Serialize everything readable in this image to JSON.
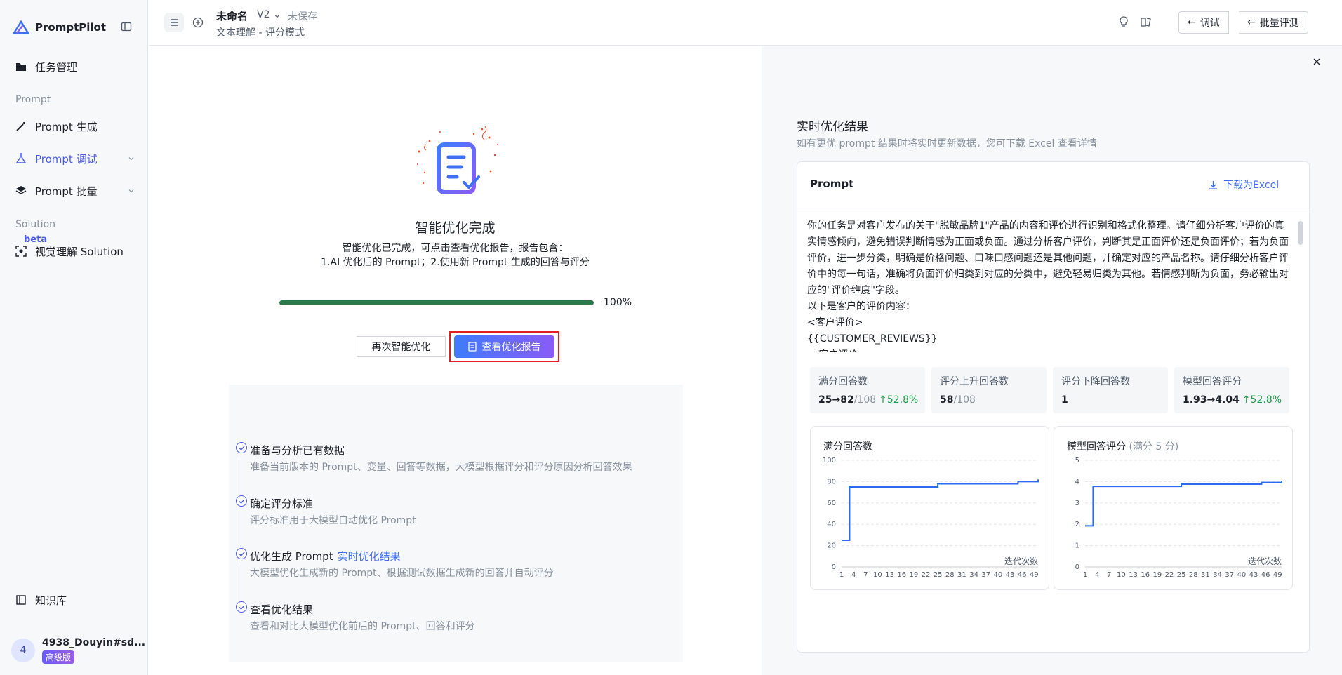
{
  "sidebar": {
    "brand": "PromptPilot",
    "items": [
      {
        "label": "任务管理",
        "icon": "folder-icon"
      },
      {
        "label": "Prompt 生成",
        "icon": "magic-wand-icon"
      },
      {
        "label": "Prompt 调试",
        "icon": "flask-icon",
        "active": true
      },
      {
        "label": "Prompt 批量",
        "icon": "stack-icon"
      },
      {
        "label": "视觉理解 Solution",
        "icon": "eye-scan-icon"
      },
      {
        "label": "知识库",
        "icon": "book-icon"
      }
    ],
    "groups": {
      "prompt": "Prompt",
      "solution": "Solution"
    },
    "beta": "beta",
    "user": {
      "avatar": "4",
      "name": "4938_Douyin#sd...",
      "tier": "高级版"
    }
  },
  "header": {
    "doc_title": "未命名",
    "version": "V2",
    "status": "未保存",
    "subtitle": "文本理解 - 评分模式",
    "debug_btn": "调试",
    "batch_btn": "批量评测"
  },
  "main": {
    "success_title": "智能优化完成",
    "success_desc_1": "智能优化已完成，可点击查看优化报告，报告包含：",
    "success_desc_2": "1.AI 优化后的 Prompt；2.使用新 Prompt 生成的回答与评分",
    "progress": 1.0,
    "progress_label": "100%",
    "retry_btn": "再次智能优化",
    "report_btn": "查看优化报告",
    "steps": [
      {
        "title": "准备与分析已有数据",
        "desc": "准备当前版本的 Prompt、变量、回答等数据，大模型根据评分和评分原因分析回答效果"
      },
      {
        "title": "确定评分标准",
        "desc": "评分标准用于大模型自动优化 Prompt"
      },
      {
        "title": "优化生成 Prompt",
        "link": "实时优化结果",
        "desc": "大模型优化生成新的 Prompt、根据测试数据生成新的回答并自动评分"
      },
      {
        "title": "查看优化结果",
        "desc": "查看和对比大模型优化前后的 Prompt、回答和评分"
      }
    ]
  },
  "right": {
    "title": "实时优化结果",
    "subtitle": "如有更优 prompt 结果时将实时更新数据，您可下载 Excel 查看详情",
    "card_title": "Prompt",
    "download": "下载为Excel",
    "prompt_text": "你的任务是对客户发布的关于\"脱敏品牌1\"产品的内容和评价进行识别和格式化整理。请仔细分析客户评价的真实情感倾向，避免错误判断情感为正面或负面。通过分析客户评价，判断其是正面评价还是负面评价；若为负面评价，进一步分类，明确是价格问题、口味口感问题还是其他问题，并确定对应的产品名称。请仔细分析客户评价中的每一句话，准确将负面评价归类到对应的分类中，避免轻易归类为其他。若情感判断为负面，务必输出对应的\"评价维度\"字段。\n以下是客户的评价内容：\n<客户评价>\n{{CUSTOMER_REVIEWS}}\n</客户评价>",
    "stats": [
      {
        "label": "满分回答数",
        "value": "25→82",
        "suffix": "/108",
        "delta": "↑52.8%"
      },
      {
        "label": "评分上升回答数",
        "value": "58",
        "suffix": "/108",
        "delta": ""
      },
      {
        "label": "评分下降回答数",
        "value": "1",
        "suffix": "",
        "delta": ""
      },
      {
        "label": "模型回答评分",
        "value": "1.93→4.04",
        "suffix": "",
        "delta": "↑52.8%"
      }
    ],
    "charts": [
      {
        "title": "满分回答数",
        "title_note": ""
      },
      {
        "title": "模型回答评分",
        "title_note": "(满分 5 分)"
      }
    ]
  },
  "chart_data": [
    {
      "type": "line",
      "title": "满分回答数",
      "xlabel": "迭代次数",
      "ylabel": "",
      "ylim": [
        0,
        100
      ],
      "yticks": [
        0,
        20,
        40,
        60,
        80,
        100
      ],
      "xticks": [
        1,
        4,
        7,
        10,
        13,
        16,
        19,
        22,
        25,
        28,
        31,
        34,
        37,
        40,
        43,
        46,
        49
      ],
      "x": [
        1,
        2,
        3,
        4,
        5,
        10,
        15,
        20,
        24,
        25,
        30,
        35,
        40,
        44,
        45,
        48,
        49,
        50
      ],
      "y": [
        25,
        25,
        75,
        75,
        75,
        75,
        75,
        75,
        75,
        78,
        78,
        78,
        78,
        78,
        80,
        80,
        80,
        82
      ]
    },
    {
      "type": "line",
      "title": "模型回答评分",
      "xlabel": "迭代次数",
      "ylabel": "",
      "ylim": [
        0,
        5
      ],
      "yticks": [
        0,
        1,
        2,
        3,
        4,
        5
      ],
      "xticks": [
        1,
        4,
        7,
        10,
        13,
        16,
        19,
        22,
        25,
        28,
        31,
        34,
        37,
        40,
        43,
        46,
        49
      ],
      "x": [
        1,
        2,
        3,
        4,
        10,
        15,
        20,
        24,
        25,
        30,
        35,
        40,
        44,
        45,
        48,
        49,
        50
      ],
      "y": [
        1.93,
        1.93,
        3.78,
        3.78,
        3.78,
        3.78,
        3.78,
        3.78,
        3.88,
        3.88,
        3.88,
        3.88,
        3.88,
        3.96,
        3.96,
        3.96,
        4.04
      ]
    }
  ]
}
